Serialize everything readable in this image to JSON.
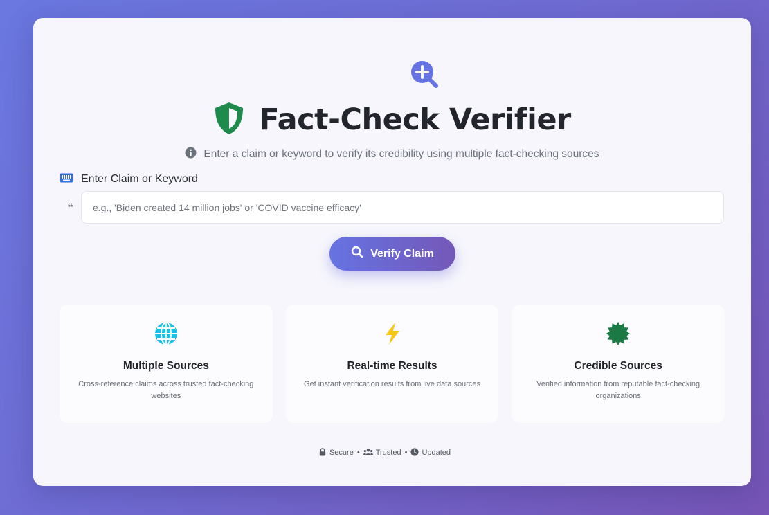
{
  "app": {
    "title": "Fact-Check Verifier",
    "subtitle": "Enter a claim or keyword to verify its credibility using multiple fact-checking sources"
  },
  "search": {
    "label": "Enter Claim or Keyword",
    "placeholder": "e.g., 'Biden created 14 million jobs' or 'COVID vaccine efficacy'",
    "value": "",
    "quote_glyph": "❝"
  },
  "actions": {
    "verify_label": "Verify Claim"
  },
  "features": [
    {
      "icon": "globe-icon",
      "title": "Multiple Sources",
      "description": "Cross-reference claims across trusted fact-checking websites"
    },
    {
      "icon": "lightning-icon",
      "title": "Real-time Results",
      "description": "Get instant verification results from live data sources"
    },
    {
      "icon": "certificate-icon",
      "title": "Credible Sources",
      "description": "Verified information from reputable fact-checking organizations"
    }
  ],
  "footer": {
    "secure": "Secure",
    "trusted": "Trusted",
    "updated": "Updated",
    "separator": "•"
  },
  "colors": {
    "accent": "#6673e3",
    "accent_end": "#7458b8",
    "shield": "#1e8a4c",
    "globe": "#17c1e8",
    "lightning": "#f5c518",
    "certificate": "#1b7a44"
  },
  "icons": {
    "hero": "search-plus-icon",
    "title": "shield-icon",
    "subtitle": "info-circle-icon",
    "label": "keyboard-icon",
    "button": "search-icon"
  }
}
